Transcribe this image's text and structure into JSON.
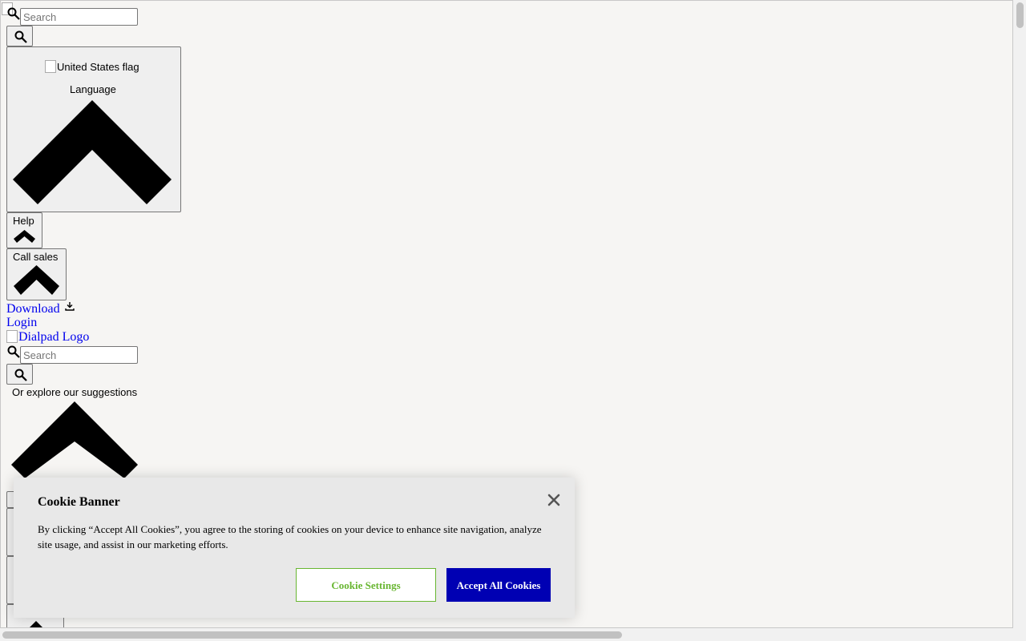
{
  "top_search": {
    "placeholder": "Search",
    "icon": "search-icon"
  },
  "language": {
    "flag_alt": "United States flag",
    "label": "Language",
    "icon": "chevron-up-icon"
  },
  "help": {
    "label": "Help",
    "icon": "chevron-up-icon"
  },
  "call_sales": {
    "label": "Call sales",
    "icon": "chevron-up-icon"
  },
  "links": {
    "download": "Download",
    "download_icon": "download-icon",
    "login": "Login",
    "logo_alt": "Dialpad Logo"
  },
  "main_search": {
    "placeholder": "Search",
    "icon": "search-icon"
  },
  "suggestions": {
    "label": "Or explore our suggestions",
    "icon": "chevron-up-icon"
  },
  "cookie_banner": {
    "title": "Cookie Banner",
    "text": "By clicking “Accept All Cookies”, you agree to the storing of cookies on your device to enhance site navigation, analyze site usage, and assist in our marketing efforts.",
    "settings_label": "Cookie Settings",
    "accept_label": "Accept All Cookies",
    "close_icon": "close-icon",
    "colors": {
      "settings": "#68b631",
      "accept": "#0000b3"
    }
  }
}
